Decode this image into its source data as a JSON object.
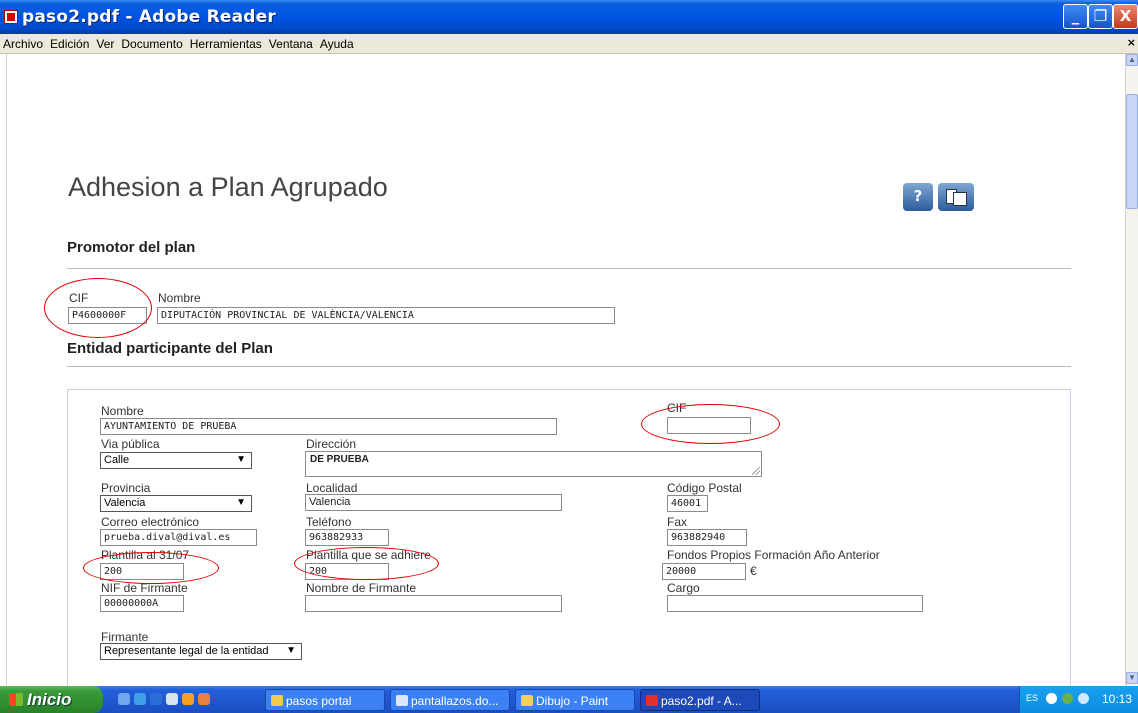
{
  "window": {
    "title": "paso2.pdf - Adobe Reader",
    "buttons": {
      "minimize": "_",
      "maximize": "❐",
      "close": "X"
    }
  },
  "menubar": {
    "items": [
      "Archivo",
      "Edición",
      "Ver",
      "Documento",
      "Herramientas",
      "Ventana",
      "Ayuda"
    ],
    "doc_close": "×"
  },
  "page": {
    "title": "Adhesion a Plan Agrupado",
    "help_icon_label": "?",
    "promotor": {
      "heading": "Promotor del plan",
      "cif_label": "CIF",
      "cif_value": "P4600000F",
      "nombre_label": "Nombre",
      "nombre_value": "DIPUTACIÓN PROVINCIAL DE VALÈNCIA/VALENCIA"
    },
    "entidad": {
      "heading": "Entidad participante del Plan",
      "nombre_label": "Nombre",
      "nombre_value": "AYUNTAMIENTO DE PRUEBA",
      "cif_label": "CIF",
      "cif_value": "",
      "via_label": "Via pública",
      "via_value": "Calle",
      "direccion_label": "Dirección",
      "direccion_value": "DE PRUEBA",
      "provincia_label": "Provincia",
      "provincia_value": "Valencia",
      "localidad_label": "Localidad",
      "localidad_value": "Valencia",
      "cp_label": "Código Postal",
      "cp_value": "46001",
      "correo_label": "Correo electrónico",
      "correo_value": "prueba.dival@dival.es",
      "telefono_label": "Teléfono",
      "telefono_value": "963882933",
      "fax_label": "Fax",
      "fax_value": "963882940",
      "plantilla_label": "Plantilla al 31/07",
      "plantilla_value": "200",
      "plantilla_adhiere_label": "Plantilla que se adhiere",
      "plantilla_adhiere_value": "200",
      "fondos_label": "Fondos Propios Formación Año Anterior",
      "fondos_value": "20000",
      "fondos_unit": "€",
      "nif_label": "NIF de Firmante",
      "nif_value": "00000000A",
      "nombre_firmante_label": "Nombre de Firmante",
      "nombre_firmante_value": "",
      "cargo_label": "Cargo",
      "cargo_value": "",
      "firmante_label": "Firmante",
      "firmante_value": "Representante legal de la entidad"
    },
    "annotation_color": "#e00000"
  },
  "taskbar": {
    "start_label": "Inicio",
    "tasks": [
      {
        "label": "pasos portal",
        "icon": "folder-icon"
      },
      {
        "label": "pantallazos.do...",
        "icon": "word-document-icon"
      },
      {
        "label": "Dibujo - Paint",
        "icon": "paint-icon"
      },
      {
        "label": "paso2.pdf - A...",
        "icon": "pdf-icon",
        "active": true
      }
    ],
    "tray": {
      "language": "ES",
      "clock": "10:13"
    }
  }
}
